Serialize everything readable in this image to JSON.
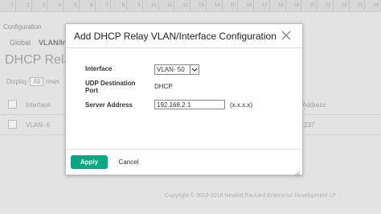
{
  "background": {
    "ruler_numbers": [
      "1",
      "2",
      "3",
      "4",
      "5",
      "6",
      "7",
      "8",
      "9",
      "10",
      "11",
      "12",
      "13",
      "14",
      "15",
      "16",
      "17",
      "18",
      "19",
      "20",
      "21",
      "22",
      "23",
      "24"
    ],
    "section_title": "Configuration",
    "tabs": [
      "Global",
      "VLAN/In"
    ],
    "page_title": "DHCP Relay",
    "display_label": "Display",
    "display_value": "All",
    "display_suffix": "rows",
    "table_headers": {
      "col1": "Interface",
      "col2": "Address"
    },
    "table_row": {
      "col1": "VLAN- 6",
      "col2": ".237"
    },
    "footer": "Copyright © 2010-2018 Hewlett Packard Enterprise Development LP"
  },
  "dialog": {
    "title": "Add DHCP Relay VLAN/Interface Configuration",
    "interface_label": "Interface",
    "interface_value": "VLAN- 50",
    "udp_label_line1": "UDP Destination",
    "udp_label_line2": "Port",
    "udp_value": "DHCP",
    "server_label": "Server Address",
    "server_value": "192.168.2.1",
    "server_hint": "(x.x.x.x)",
    "apply_label": "Apply",
    "cancel_label": "Cancel",
    "accent_color": "#01a982"
  }
}
